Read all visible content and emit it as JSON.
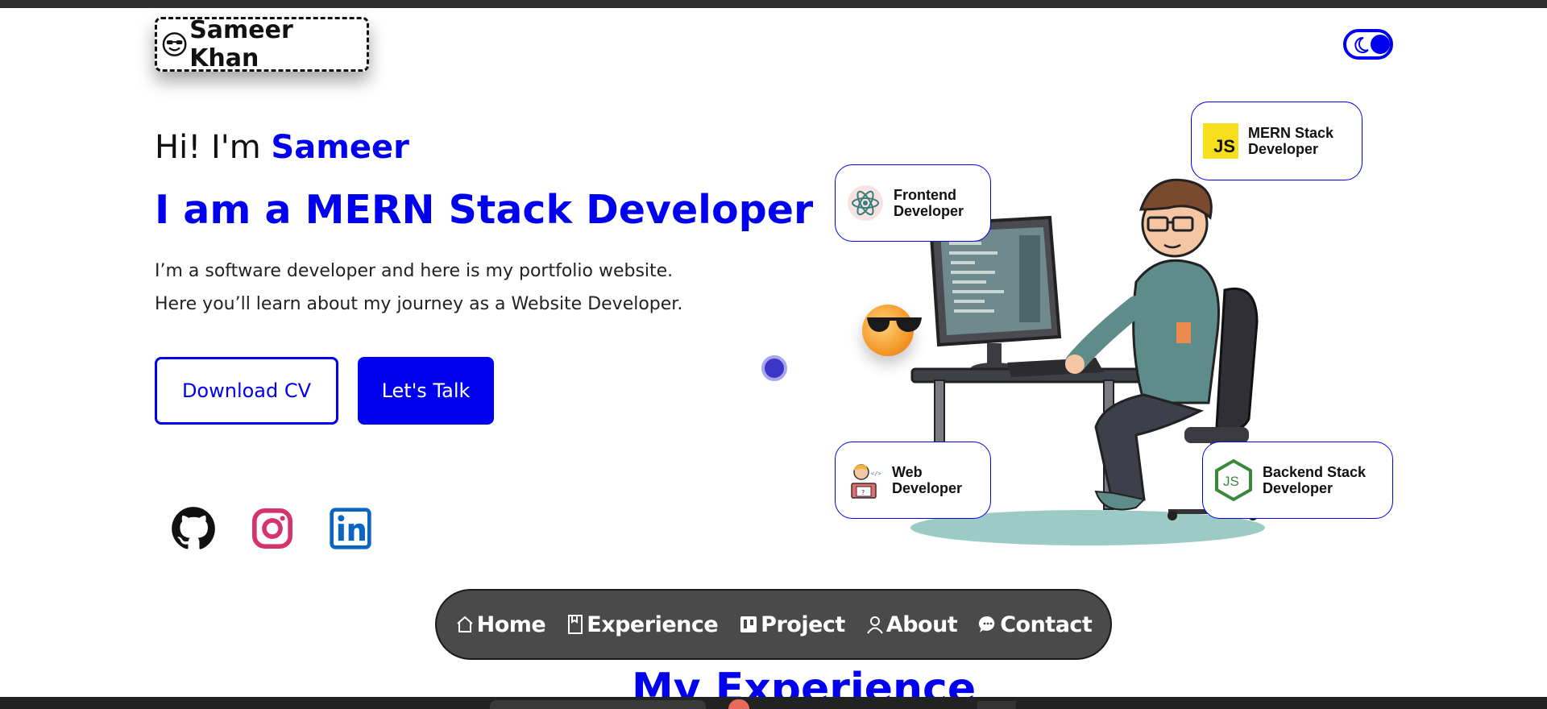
{
  "header": {
    "logo_text": "Sameer Khan",
    "logo_icon": "smiling-face-with-sunglasses-icon",
    "theme_toggle_icon": "moon-icon"
  },
  "hero": {
    "greeting_prefix": "Hi! I'm ",
    "greeting_name": "Sameer",
    "headline": "I am a MERN Stack Developer",
    "intro_line1": "I’m a software developer and here is my portfolio website.",
    "intro_line2": "Here you’ll learn about my journey as a Website Developer.",
    "download_cv_label": "Download CV",
    "lets_talk_label": "Let's Talk"
  },
  "social": [
    {
      "name": "github-icon"
    },
    {
      "name": "instagram-icon"
    },
    {
      "name": "linkedin-icon"
    }
  ],
  "badges": {
    "frontend": {
      "line1": "Frontend",
      "line2": "Developer",
      "icon": "react-icon"
    },
    "mern": {
      "line1": "MERN Stack",
      "line2": "Developer",
      "icon": "javascript-icon",
      "icon_text": "JS"
    },
    "web": {
      "line1": "Web",
      "line2": "Developer",
      "icon": "developer-avatar-icon"
    },
    "backend": {
      "line1": "Backend Stack",
      "line2": "Developer",
      "icon": "nodejs-icon"
    }
  },
  "dock": {
    "home": "Home",
    "experience": "Experience",
    "project": "Project",
    "about": "About",
    "contact": "Contact"
  },
  "next_section_title": "My Experience",
  "colors": {
    "accent": "#0000ee",
    "dock_bg": "#4a4a4a",
    "instagram": "#d6336c",
    "linkedin": "#0a66c2"
  }
}
